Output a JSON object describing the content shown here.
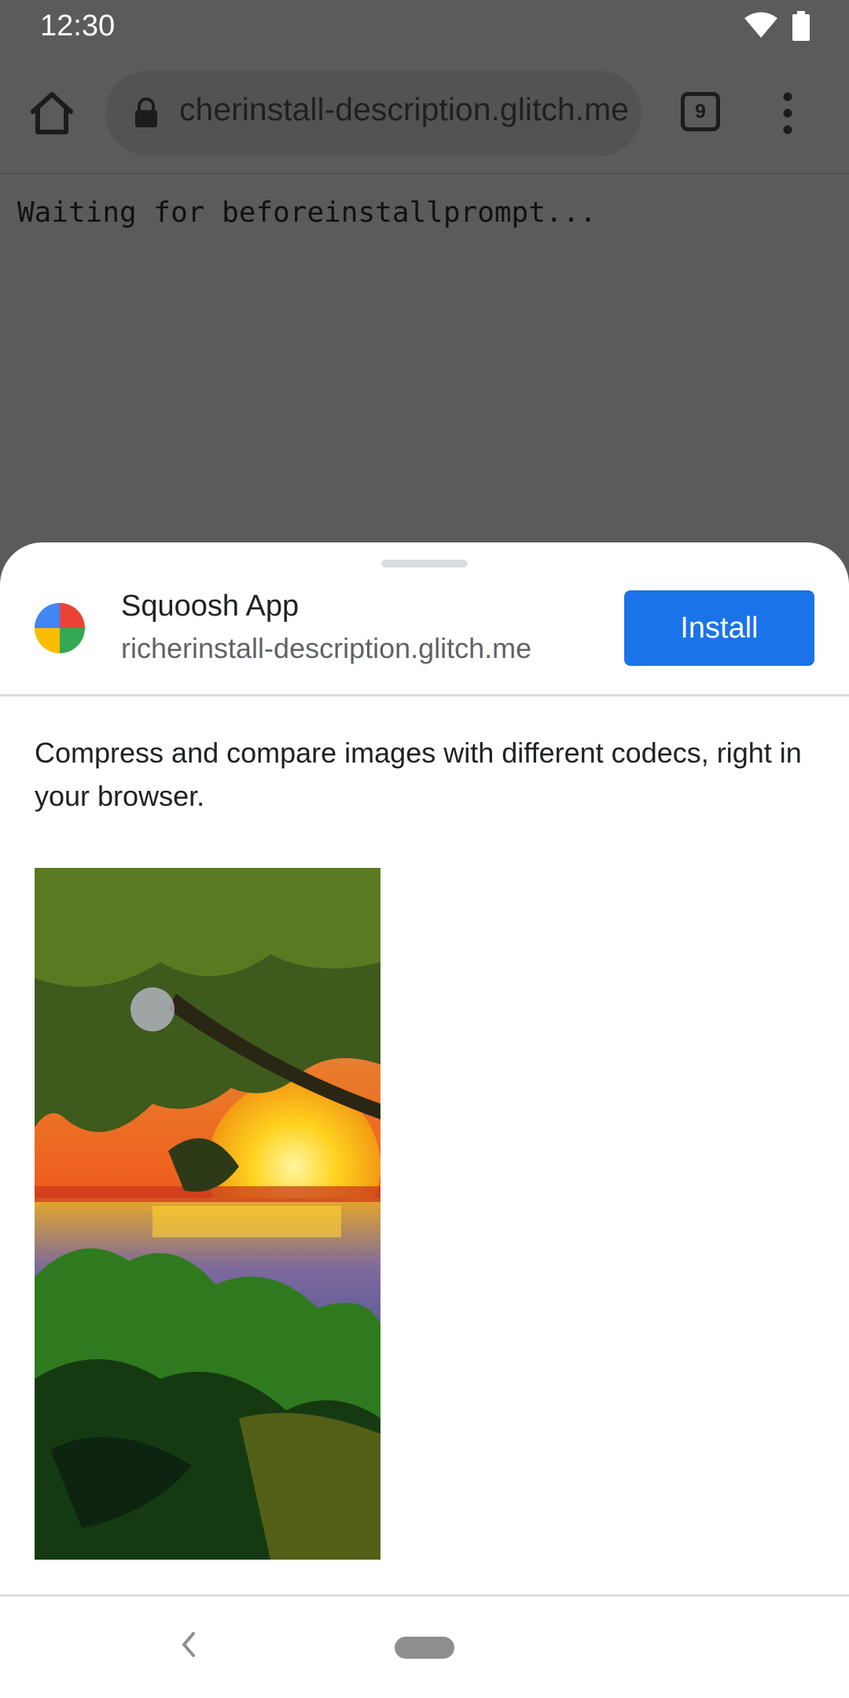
{
  "status_bar": {
    "time": "12:30",
    "icons": [
      "wifi-icon",
      "battery-icon"
    ]
  },
  "browser": {
    "url": "richerinstall-description.glitch.me",
    "tab_count": "9",
    "icons": [
      "home-icon",
      "lock-icon",
      "tab-switcher-icon",
      "more-vert-icon"
    ]
  },
  "page": {
    "status_text": "Waiting for beforeinstallprompt..."
  },
  "install_sheet": {
    "app_name": "Squoosh App",
    "origin": "richerinstall-description.glitch.me",
    "install_label": "Install",
    "description": "Compress and compare images with different codecs, right in your browser.",
    "screenshot_alt": "sunset-over-water-through-trees"
  },
  "nav_bar": {
    "icons": [
      "back-icon",
      "home-pill"
    ]
  },
  "colors": {
    "scrim": "#5b5b5b",
    "accent": "#1a73e8",
    "sheet_bg": "#ffffff"
  }
}
